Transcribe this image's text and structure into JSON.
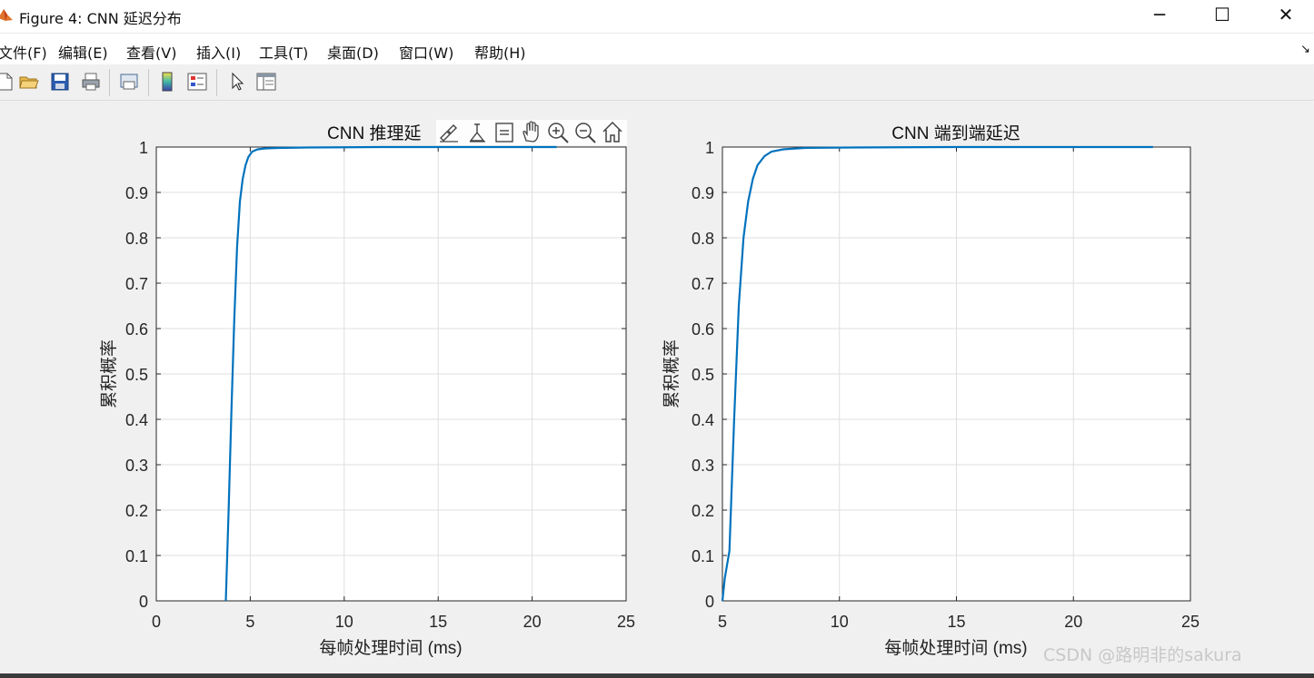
{
  "window": {
    "title": "Figure 4: CNN 延迟分布",
    "minimize_glyph": "─",
    "maximize_glyph": "☐",
    "close_glyph": "✕",
    "app_icon": "matlab-icon"
  },
  "menu": {
    "items": [
      "文件(F)",
      "编辑(E)",
      "查看(V)",
      "插入(I)",
      "工具(T)",
      "桌面(D)",
      "窗口(W)",
      "帮助(H)"
    ],
    "overflow_glyph": "↘"
  },
  "toolbar": {
    "icons": [
      "new-figure-icon",
      "open-icon",
      "save-icon",
      "print-icon",
      "print-preview-icon",
      "insert-colorbar-icon",
      "insert-legend-icon",
      "edit-plot-icon",
      "property-inspector-icon"
    ]
  },
  "axes_toolbar": {
    "icons": [
      "brush-icon",
      "data-tips-icon",
      "export-icon",
      "pan-icon",
      "zoom-in-icon",
      "zoom-out-icon",
      "restore-view-icon"
    ]
  },
  "watermark": "CSDN @路明非的sakura",
  "colors": {
    "line": "#0072BD",
    "grid": "#dfdfdf",
    "axes_bg": "#ffffff",
    "figure_bg": "#f0f0f0"
  },
  "chart_data": [
    {
      "type": "line",
      "title": "CNN 推理延",
      "xlabel": "每帧处理时间 (ms)",
      "ylabel": "累积概率",
      "xlim": [
        0,
        25
      ],
      "ylim": [
        0,
        1
      ],
      "xticks": [
        0,
        5,
        10,
        15,
        20,
        25
      ],
      "yticks": [
        0,
        0.1,
        0.2,
        0.3,
        0.4,
        0.5,
        0.6,
        0.7,
        0.8,
        0.9,
        1
      ],
      "xticklabels": [
        "0",
        "5",
        "10",
        "15",
        "20",
        "25"
      ],
      "yticklabels": [
        "0",
        "0.1",
        "0.2",
        "0.3",
        "0.4",
        "0.5",
        "0.6",
        "0.7",
        "0.8",
        "0.9",
        "1"
      ],
      "grid": true,
      "series": [
        {
          "x": [
            3.7,
            3.85,
            4.0,
            4.15,
            4.3,
            4.45,
            4.6,
            4.75,
            4.9,
            5.1,
            5.4,
            5.8,
            6.5,
            8.0,
            12.0,
            21.3
          ],
          "y": [
            0,
            0.2,
            0.42,
            0.62,
            0.78,
            0.88,
            0.93,
            0.96,
            0.978,
            0.99,
            0.995,
            0.997,
            0.998,
            0.999,
            1.0,
            1.0
          ]
        }
      ]
    },
    {
      "type": "line",
      "title": "CNN 端到端延迟",
      "xlabel": "每帧处理时间 (ms)",
      "ylabel": "累积概率",
      "xlim": [
        5,
        25
      ],
      "ylim": [
        0,
        1
      ],
      "xticks": [
        5,
        10,
        15,
        20,
        25
      ],
      "yticks": [
        0,
        0.1,
        0.2,
        0.3,
        0.4,
        0.5,
        0.6,
        0.7,
        0.8,
        0.9,
        1
      ],
      "xticklabels": [
        "5",
        "10",
        "15",
        "20",
        "25"
      ],
      "yticklabels": [
        "0",
        "0.1",
        "0.2",
        "0.3",
        "0.4",
        "0.5",
        "0.6",
        "0.7",
        "0.8",
        "0.9",
        "1"
      ],
      "grid": true,
      "series": [
        {
          "x": [
            5.0,
            5.1,
            5.3,
            5.5,
            5.7,
            5.9,
            6.1,
            6.3,
            6.5,
            6.8,
            7.1,
            7.6,
            8.5,
            10.5,
            15.0,
            23.4
          ],
          "y": [
            0,
            0.05,
            0.11,
            0.4,
            0.65,
            0.8,
            0.88,
            0.93,
            0.96,
            0.98,
            0.99,
            0.995,
            0.998,
            0.999,
            1.0,
            1.0
          ]
        }
      ]
    }
  ]
}
